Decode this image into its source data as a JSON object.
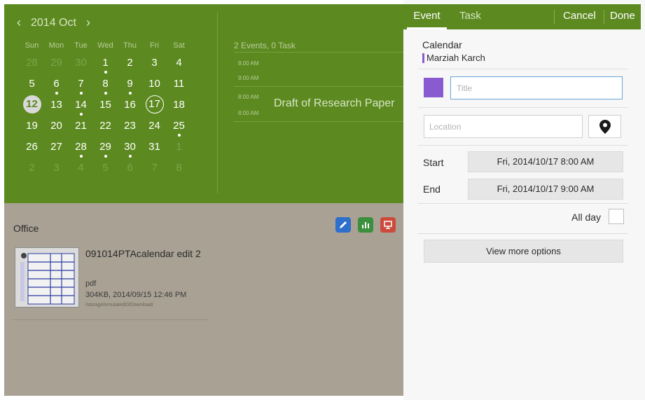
{
  "calendar": {
    "month_label": "2014 Oct",
    "prev_icon": "chevron-left-icon",
    "next_icon": "chevron-right-icon",
    "weekdays": [
      "Sun",
      "Mon",
      "Tue",
      "Wed",
      "Thu",
      "Fri",
      "Sat"
    ],
    "weeks": [
      [
        {
          "d": "28",
          "dim": true
        },
        {
          "d": "29",
          "dim": true
        },
        {
          "d": "30",
          "dim": true
        },
        {
          "d": "1",
          "dot": true
        },
        {
          "d": "2"
        },
        {
          "d": "3"
        },
        {
          "d": "4"
        }
      ],
      [
        {
          "d": "5"
        },
        {
          "d": "6",
          "dot": true
        },
        {
          "d": "7",
          "dot": true
        },
        {
          "d": "8",
          "dot": true
        },
        {
          "d": "9",
          "dot": true
        },
        {
          "d": "10"
        },
        {
          "d": "11"
        }
      ],
      [
        {
          "d": "12",
          "today": true
        },
        {
          "d": "13"
        },
        {
          "d": "14",
          "dot": true
        },
        {
          "d": "15"
        },
        {
          "d": "16"
        },
        {
          "d": "17",
          "selected": true
        },
        {
          "d": "18"
        }
      ],
      [
        {
          "d": "19"
        },
        {
          "d": "20"
        },
        {
          "d": "21"
        },
        {
          "d": "22"
        },
        {
          "d": "23"
        },
        {
          "d": "24"
        },
        {
          "d": "25",
          "dot": true
        }
      ],
      [
        {
          "d": "26"
        },
        {
          "d": "27"
        },
        {
          "d": "28",
          "dot": true
        },
        {
          "d": "29",
          "dot": true
        },
        {
          "d": "30",
          "dot": true
        },
        {
          "d": "31"
        },
        {
          "d": "1",
          "dim": true
        }
      ],
      [
        {
          "d": "2",
          "dim": true
        },
        {
          "d": "3",
          "dim": true
        },
        {
          "d": "4",
          "dim": true
        },
        {
          "d": "5",
          "dim": true
        },
        {
          "d": "6",
          "dim": true
        },
        {
          "d": "7",
          "dim": true
        },
        {
          "d": "8",
          "dim": true
        }
      ]
    ]
  },
  "day_view": {
    "summary": "2 Events, 0 Task",
    "times": [
      "8:00 AM",
      "9:00 AM",
      "8:00 AM",
      "8:00 AM"
    ],
    "event_title": "Draft of Research Paper"
  },
  "office": {
    "title": "Office",
    "app_icons": [
      "pen-icon",
      "chart-icon",
      "presentation-icon"
    ],
    "file": {
      "name": "091014PTAcalendar edit 2",
      "type": "pdf",
      "meta": "304KB, 2014/09/15 12:46 PM",
      "path": "/storage/emulated/0/Download/"
    }
  },
  "editor": {
    "tabs": [
      "Event",
      "Task"
    ],
    "active_tab": "Event",
    "cancel_label": "Cancel",
    "done_label": "Done",
    "calendar_label": "Calendar",
    "calendar_owner": "Marziah Karch",
    "calendar_color": "#8a5bd0",
    "title_placeholder": "Title",
    "location_placeholder": "Location",
    "location_icon": "map-pin-icon",
    "start_label": "Start",
    "start_value": "Fri, 2014/10/17 8:00 AM",
    "end_label": "End",
    "end_value": "Fri, 2014/10/17 9:00 AM",
    "all_day_label": "All day",
    "all_day_checked": false,
    "more_options_label": "View more options"
  },
  "colors": {
    "header_green": "#5c8a20",
    "dimmed_background": "#a8a194",
    "input_focus_blue": "#6aa5d6"
  }
}
